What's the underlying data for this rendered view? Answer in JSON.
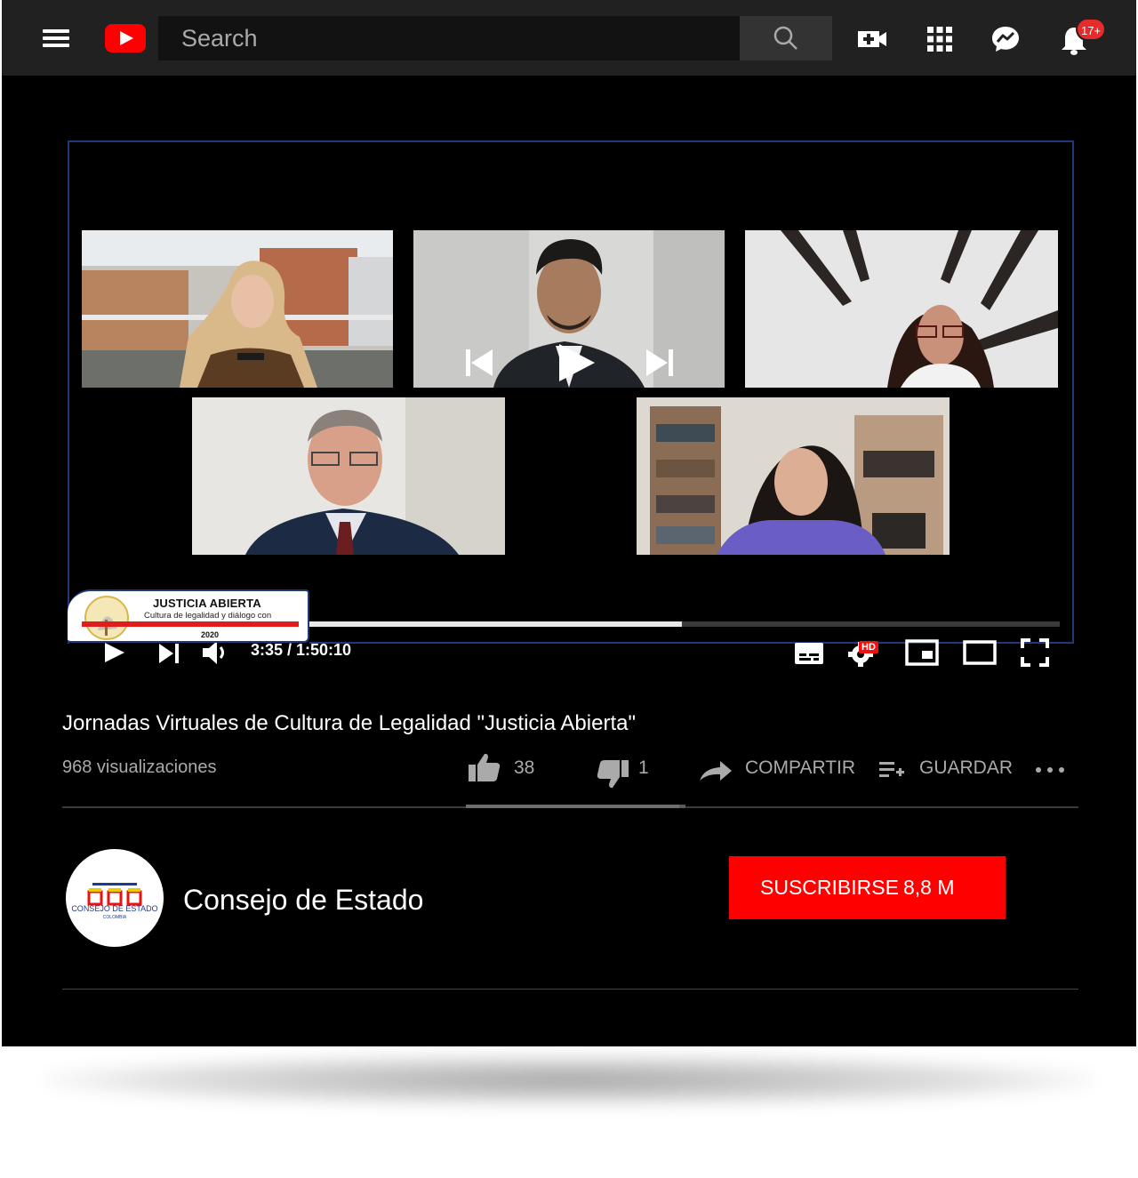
{
  "header": {
    "search_placeholder": "Search",
    "notification_badge": "17+",
    "icons": [
      "menu-icon",
      "youtube-logo",
      "search-icon",
      "create-video-icon",
      "apps-grid-icon",
      "messages-icon",
      "notifications-icon"
    ]
  },
  "player": {
    "time_current": "3:35",
    "time_total": "1:50:10",
    "time_display": "3:35 / 1:50:10",
    "progress_fraction": 0.55,
    "hd_badge": "HD",
    "overlay_card": {
      "title": "JUSTICIA ABIERTA",
      "subtitle": "Cultura de legalidad y diálogo con",
      "year": "2020"
    },
    "participants": [
      "participant-1",
      "participant-2",
      "participant-3",
      "participant-4",
      "participant-5"
    ]
  },
  "video": {
    "title": "Jornadas Virtuales de Cultura de Legalidad \"Justicia Abierta\"",
    "views": "968 visualizaciones",
    "likes": "38",
    "dislikes": "1",
    "share_label": "COMPARTIR",
    "save_label": "GUARDAR"
  },
  "channel": {
    "name": "Consejo de Estado",
    "logo_text": "CONSEJO DE ESTADO",
    "logo_subtext": "COLOMBIA",
    "subscribe_label": "SUSCRIBIRSE",
    "subscriber_count": "8,8 M"
  },
  "colors": {
    "accent": "#ff0000",
    "background": "#000000",
    "topbar": "#212121"
  }
}
